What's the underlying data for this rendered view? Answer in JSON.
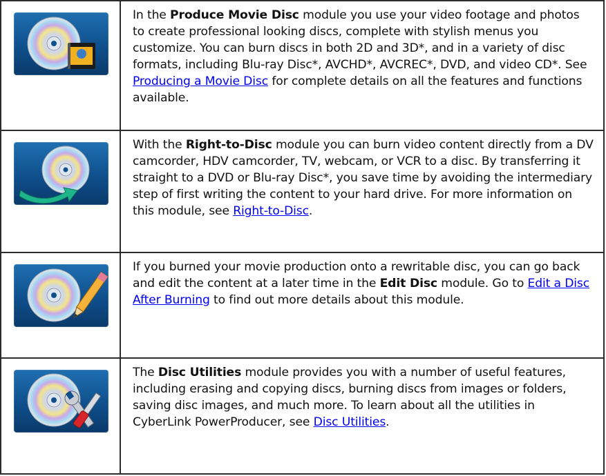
{
  "rows": [
    {
      "icon": "disc-with-film-icon",
      "p1": "In the ",
      "bold": "Produce Movie Disc",
      "p2": " module you use your video footage and photos to create professional looking discs, complete with stylish menus you customize. You can burn discs in both 2D and 3D*, and in a variety of disc formats, including Blu-ray Disc*, AVCHD*, AVCREC*, DVD, and video CD*. See ",
      "link": "Producing a Movie Disc",
      "p3": " for complete details on all the features and functions available."
    },
    {
      "icon": "disc-with-arrow-icon",
      "p1": "With the ",
      "bold": "Right-to-Disc",
      "p2": " module you can burn video content directly from a DV camcorder, HDV camcorder, TV, webcam, or VCR to a disc. By transferring it straight to a DVD or Blu-ray Disc*, you save time by avoiding the intermediary step of first writing the content to your hard drive. For more information on this module, see ",
      "link": "Right-to-Disc",
      "p3": "."
    },
    {
      "icon": "disc-with-pencil-icon",
      "p1": "If you burned your movie production onto a rewritable disc, you can go back and edit the content at a later time in the ",
      "bold": "Edit Disc",
      "p2": " module. Go to ",
      "link": "Edit a Disc After Burning",
      "p3": " to find out more details about this module."
    },
    {
      "icon": "disc-with-tools-icon",
      "p1": "The ",
      "bold": "Disc Utilities",
      "p2": " module provides you with a number of useful features, including erasing and copying discs, burning discs from images or folders, saving disc images, and much more. To learn about all the utilities in CyberLink PowerProducer, see ",
      "link": "Disc Utilities",
      "p3": "."
    }
  ]
}
